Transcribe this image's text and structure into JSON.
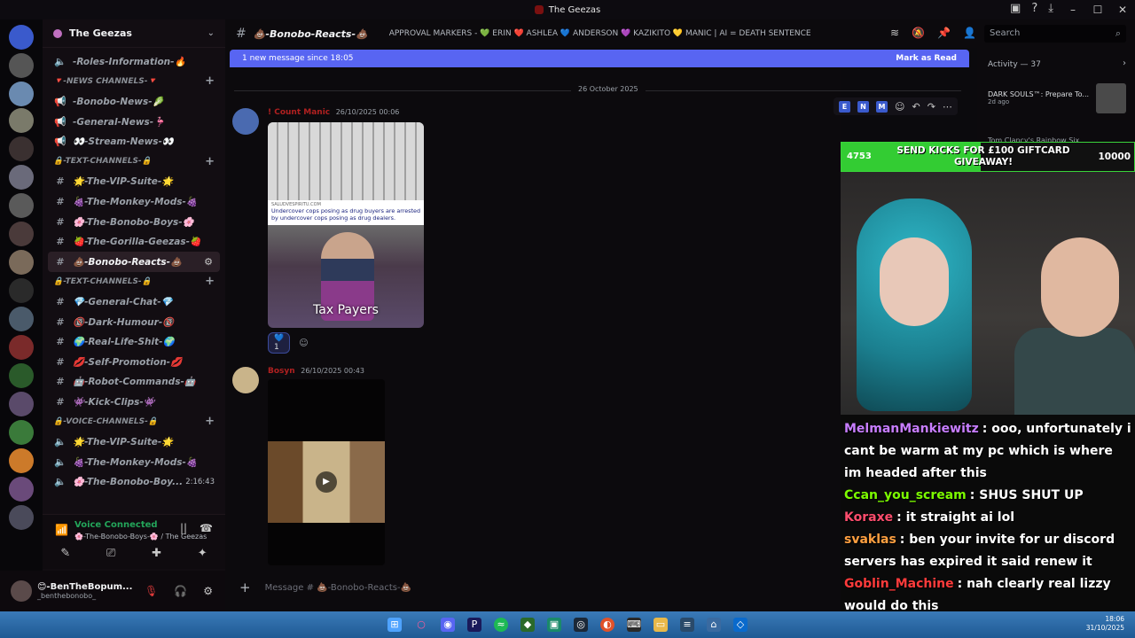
{
  "window": {
    "title": "The Geezas"
  },
  "server": {
    "name": "The Geezas"
  },
  "sidebar": {
    "items": [
      {
        "kind": "channel",
        "icon": "🔈",
        "label": "-Roles-Information-🔥"
      },
      {
        "kind": "category",
        "label": "🔻-NEWS CHANNELS-🔻"
      },
      {
        "kind": "channel",
        "icon": "📢",
        "label": "-Bonobo-News-🥬"
      },
      {
        "kind": "channel",
        "icon": "📢",
        "label": "-General-News-🦩"
      },
      {
        "kind": "channel",
        "icon": "📢",
        "label": "👀-Stream-News-👀"
      },
      {
        "kind": "category",
        "label": "🔒-TEXT-CHANNELS-🔒"
      },
      {
        "kind": "channel",
        "icon": "#",
        "label": "🌟-The-VIP-Suite-🌟"
      },
      {
        "kind": "channel",
        "icon": "#",
        "label": "🍇-The-Monkey-Mods-🍇"
      },
      {
        "kind": "channel",
        "icon": "#",
        "label": "🌸-The-Bonobo-Boys-🌸"
      },
      {
        "kind": "channel",
        "icon": "#",
        "label": "🍓-The-Gorilla-Geezas-🍓"
      },
      {
        "kind": "channel",
        "icon": "#",
        "label": "💩-Bonobo-Reacts-💩",
        "active": true
      },
      {
        "kind": "category",
        "label": "🔒-TEXT-CHANNELS-🔒"
      },
      {
        "kind": "channel",
        "icon": "#",
        "label": "💎-General-Chat-💎"
      },
      {
        "kind": "channel",
        "icon": "#",
        "label": "🔞-Dark-Humour-🔞"
      },
      {
        "kind": "channel",
        "icon": "#",
        "label": "🌍-Real-Life-Shit-🌍"
      },
      {
        "kind": "channel",
        "icon": "#",
        "label": "💋-Self-Promotion-💋"
      },
      {
        "kind": "channel",
        "icon": "#",
        "label": "🤖-Robot-Commands-🤖"
      },
      {
        "kind": "channel",
        "icon": "#",
        "label": "👾-Kick-Clips-👾"
      },
      {
        "kind": "category",
        "label": "🔒-VOICE-CHANNELS-🔒"
      },
      {
        "kind": "channel",
        "icon": "🔈",
        "label": "🌟-The-VIP-Suite-🌟"
      },
      {
        "kind": "channel",
        "icon": "🔈",
        "label": "🍇-The-Monkey-Mods-🍇"
      },
      {
        "kind": "channel",
        "icon": "🔈",
        "label": "🌸-The-Bonobo-Boy...",
        "time": "2:16:43"
      }
    ]
  },
  "voice": {
    "status": "Voice Connected",
    "location": "🌸-The-Bonobo-Boys-🌸 / The Geezas"
  },
  "user": {
    "name": "😊-BenTheBopum...",
    "handle": "_benthebonobo_"
  },
  "channel": {
    "name": "💩-Bonobo-Reacts-💩",
    "topic": "APPROVAL MARKERS - 💚 ERIN ❤️ ASHLEA 💙 ANDERSON 💜 KAZIKITO 💛 MANIC | AI = DEATH SENTENCE"
  },
  "search": {
    "placeholder": "Search"
  },
  "new_messages": {
    "text": "1 new message since 18:05",
    "action": "Mark as Read"
  },
  "date_divider": "26 October 2025",
  "messages": [
    {
      "author": "! Count Manic",
      "timestamp": "26/10/2025 00:06",
      "meme": {
        "source": "SALUDVESPIRITU.COM",
        "caption_line1": "Undercover cops posing as drug buyers are arrested",
        "caption_line2": "by undercover cops posing as drug dealers.",
        "overlay_text": "Tax Payers"
      },
      "reaction_count": "1"
    },
    {
      "author": "Bosyn",
      "timestamp": "26/10/2025 00:43"
    }
  ],
  "composer": {
    "placeholder": "Message # 💩-Bonobo-Reacts-💩"
  },
  "activity": {
    "title": "Activity — 37",
    "item1_title": "DARK SOULS™: Prepare To...",
    "item1_sub": "2d ago",
    "item2_title": "Tom Clancy's Rainbow Six..."
  },
  "stream": {
    "count": "4753",
    "goal_text": "SEND KICKS FOR £100 GIFTCARD GIVEAWAY!",
    "goal": "10000",
    "chat": [
      {
        "user": "MelmanMankiewitz",
        "color": "#c77dff",
        "text": ": ooo, unfortunately i cant be warm at my pc which is where im headed after this"
      },
      {
        "user": "Ccan_you_scream",
        "color": "#7cfc00",
        "text": ": SHUS SHUT UP"
      },
      {
        "user": "Koraxe",
        "color": "#ff4d6d",
        "text": ": it straight ai lol"
      },
      {
        "user": "svaklas",
        "color": "#ffa040",
        "text": ": ben your invite for ur discord servers has expired it said renew it"
      },
      {
        "user": "Goblin_Machine",
        "color": "#ff3b3b",
        "text": ": nah clearly real lizzy would do this"
      }
    ]
  },
  "clock": {
    "time": "18:06",
    "date": "31/10/2025"
  },
  "colors": {
    "accent": "#5865f2",
    "online": "#23a55a",
    "danger": "#e23b3b",
    "goal_green": "#33cc33"
  }
}
